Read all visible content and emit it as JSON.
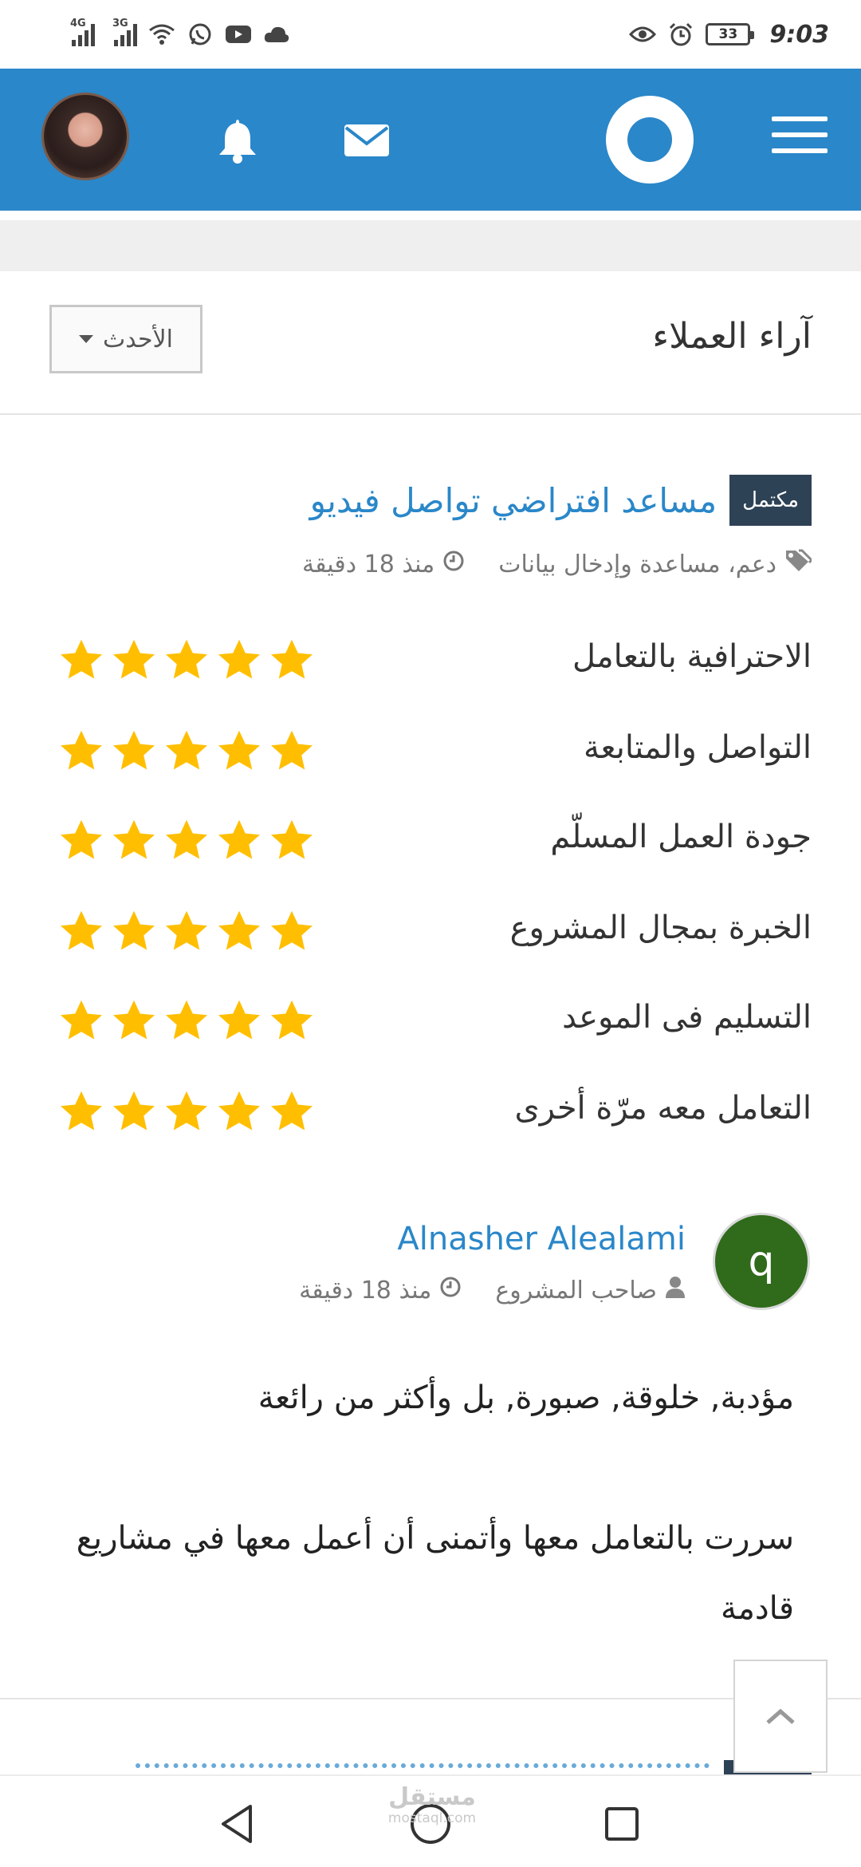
{
  "status_bar": {
    "signal_1_label": "4G",
    "signal_2_label": "3G",
    "battery": "33",
    "time": "9:03"
  },
  "header": {
    "menu_icon": "hamburger-menu-icon",
    "logo_icon": "ring-logo-icon",
    "messages_icon": "envelope-icon",
    "notifications_icon": "bell-icon"
  },
  "reviews": {
    "title": "آراء العملاء",
    "sort_label": "الأحدث"
  },
  "project": {
    "status_badge": "مكتمل",
    "title": "مساعد افتراضي تواصل فيديو",
    "tags": "دعم، مساعدة وإدخال بيانات",
    "time_ago": "منذ 18 دقيقة"
  },
  "ratings": [
    {
      "label": "الاحترافية بالتعامل",
      "stars": 5
    },
    {
      "label": "التواصل والمتابعة",
      "stars": 5
    },
    {
      "label": "جودة العمل المسلّم",
      "stars": 5
    },
    {
      "label": "الخبرة بمجال المشروع",
      "stars": 5
    },
    {
      "label": "التسليم فى الموعد",
      "stars": 5
    },
    {
      "label": "التعامل معه مرّة أخرى",
      "stars": 5
    }
  ],
  "reviewer": {
    "avatar_letter": "q",
    "name": "Alnasher Alealami",
    "role": "صاحب المشروع",
    "time_ago": "منذ 18 دقيقة",
    "comment_1": "مؤدبة, خلوقة, صبورة, بل وأكثر من رائعة",
    "comment_2": "سررت بالتعامل معها وأتمنى أن أعمل معها في مشاريع قادمة"
  },
  "watermark": {
    "brand_ar": "مستقل",
    "brand_en": "mostaql.com"
  },
  "colors": {
    "primary": "#2a87c9",
    "badge": "#2e4256",
    "star": "#ffbf00",
    "reviewer_avatar": "#2f6b1a"
  }
}
